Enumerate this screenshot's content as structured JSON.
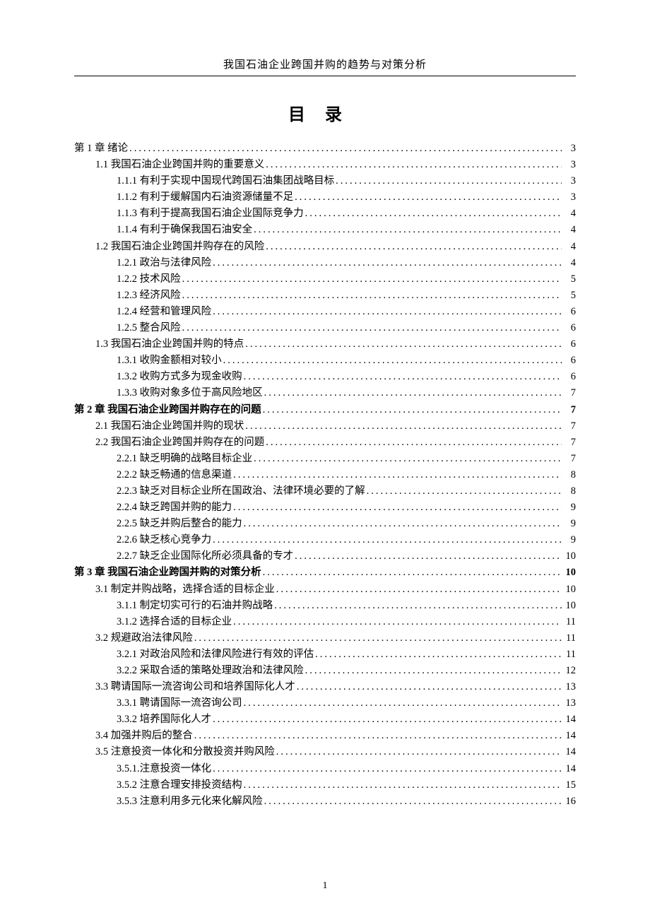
{
  "docHeader": "我国石油企业跨国并购的趋势与对策分析",
  "tocTitle": "目录",
  "pageNumber": "1",
  "entries": [
    {
      "level": 0,
      "label": "第 1 章   绪论",
      "page": "3"
    },
    {
      "level": 1,
      "label": "1.1 我国石油企业跨国并购的重要意义",
      "page": "3"
    },
    {
      "level": 2,
      "label": "1.1.1 有利于实现中国现代跨国石油集团战略目标",
      "page": "3"
    },
    {
      "level": 2,
      "label": "1.1.2 有利于缓解国内石油资源储量不足",
      "page": "3"
    },
    {
      "level": 2,
      "label": "1.1.3 有利于提高我国石油企业国际竞争力",
      "page": "4"
    },
    {
      "level": 2,
      "label": "1.1.4 有利于确保我国石油安全",
      "page": "4"
    },
    {
      "level": 1,
      "label": "1.2 我国石油企业跨国并购存在的风险",
      "page": "4"
    },
    {
      "level": 2,
      "label": "1.2.1 政治与法律风险",
      "page": "4"
    },
    {
      "level": 2,
      "label": "1.2.2 技术风险",
      "page": "5"
    },
    {
      "level": 2,
      "label": "1.2.3 经济风险",
      "page": "5"
    },
    {
      "level": 2,
      "label": "1.2.4 经营和管理风险",
      "page": "6"
    },
    {
      "level": 2,
      "label": "1.2.5 整合风险",
      "page": "6"
    },
    {
      "level": 1,
      "label": "1.3  我国石油企业跨国并购的特点",
      "page": "6"
    },
    {
      "level": 2,
      "label": "1.3.1 收购金额相对较小",
      "page": "6"
    },
    {
      "level": 2,
      "label": "1.3.2 收购方式多为现金收购",
      "page": "6"
    },
    {
      "level": 2,
      "label": "1.3.3 收购对象多位于高风险地区",
      "page": "7"
    },
    {
      "level": 0,
      "label": "第 2 章   我国石油企业跨国并购存在的问题",
      "page": "7",
      "bold": true
    },
    {
      "level": 1,
      "label": "2.1  我国石油企业跨国并购的现状",
      "page": "7"
    },
    {
      "level": 1,
      "label": "2.2  我国石油企业跨国并购存在的问题",
      "page": "7"
    },
    {
      "level": 2,
      "label": "2.2.1 缺乏明确的战略目标企业",
      "page": "7"
    },
    {
      "level": 2,
      "label": "2.2.2   缺乏畅通的信息渠道",
      "page": "8"
    },
    {
      "level": 2,
      "label": "2.2.3   缺乏对目标企业所在国政治、法律环境必要的了解",
      "page": "8"
    },
    {
      "level": 2,
      "label": "2.2.4   缺乏跨国并购的能力",
      "page": "9"
    },
    {
      "level": 2,
      "label": "2.2.5   缺乏并购后整合的能力",
      "page": "9"
    },
    {
      "level": 2,
      "label": "2.2.6   缺乏核心竞争力",
      "page": "9"
    },
    {
      "level": 2,
      "label": "2.2.7   缺乏企业国际化所必须具备的专才",
      "page": "10"
    },
    {
      "level": 0,
      "label": "第 3 章   我国石油企业跨国并购的对策分析",
      "page": "10",
      "bold": true
    },
    {
      "level": 1,
      "label": "3.1 制定并购战略，选择合适的目标企业",
      "page": "10"
    },
    {
      "level": 2,
      "label": "3.1.1 制定切实可行的石油并购战略",
      "page": " 10"
    },
    {
      "level": 2,
      "label": "3.1.2 选择合适的目标企业",
      "page": "11"
    },
    {
      "level": 1,
      "label": "3.2  规避政治法律风险",
      "page": "11"
    },
    {
      "level": 2,
      "label": "3.2.1  对政治风险和法律风险进行有效的评估",
      "page": "11"
    },
    {
      "level": 2,
      "label": "3.2.2 采取合适的策略处理政治和法律风险",
      "page": "12"
    },
    {
      "level": 1,
      "label": "3.3 聘请国际一流咨询公司和培养国际化人才",
      "page": "13"
    },
    {
      "level": 2,
      "label": "3.3.1   聘请国际一流咨询公司",
      "page": "13"
    },
    {
      "level": 2,
      "label": "3.3.2   培养国际化人才",
      "page": "14"
    },
    {
      "level": 1,
      "label": "3.4 加强并购后的整合",
      "page": "14"
    },
    {
      "level": 1,
      "label": "3.5 注意投资一体化和分散投资并购风险",
      "page": "14"
    },
    {
      "level": 2,
      "label": "3.5.1.注意投资一体化",
      "page": "14"
    },
    {
      "level": 2,
      "label": "3.5.2 注意合理安排投资结构",
      "page": "15"
    },
    {
      "level": 2,
      "label": "3.5.3 注意利用多元化来化解风险",
      "page": "16"
    }
  ]
}
